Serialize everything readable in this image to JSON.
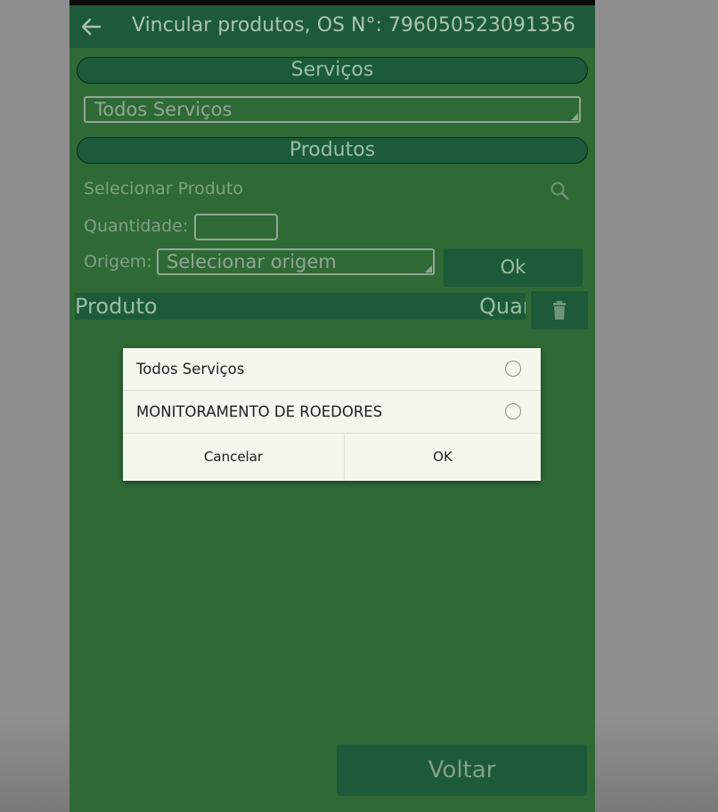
{
  "app_title": "Vincular produtos, OS N°: 796050523091356",
  "sections": {
    "servicos_label": "Serviços",
    "produtos_label": "Produtos"
  },
  "servicos_select": {
    "value": "Todos Serviços"
  },
  "produto_search": {
    "placeholder": "Selecionar Produto"
  },
  "quantidade": {
    "label": "Quantidade:",
    "value": ""
  },
  "origem": {
    "label": "Origem:",
    "value": "Selecionar origem"
  },
  "ok_button_label": "Ok",
  "table": {
    "columns": [
      "Produto",
      "Quantidade"
    ]
  },
  "voltar_button_label": "Voltar",
  "dialog": {
    "options": [
      {
        "label": "Todos Serviços",
        "selected": false
      },
      {
        "label": "MONITORAMENTO DE ROEDORES",
        "selected": false
      }
    ],
    "cancel_label": "Cancelar",
    "ok_label": "OK"
  },
  "colors": {
    "app_bar": "#1d5a39",
    "screen_dimmed": "#2f6a36",
    "dialog_bg": "#f3f7ee"
  },
  "icons": [
    "back-arrow-icon",
    "search-icon",
    "trash-icon",
    "radio-icon"
  ]
}
